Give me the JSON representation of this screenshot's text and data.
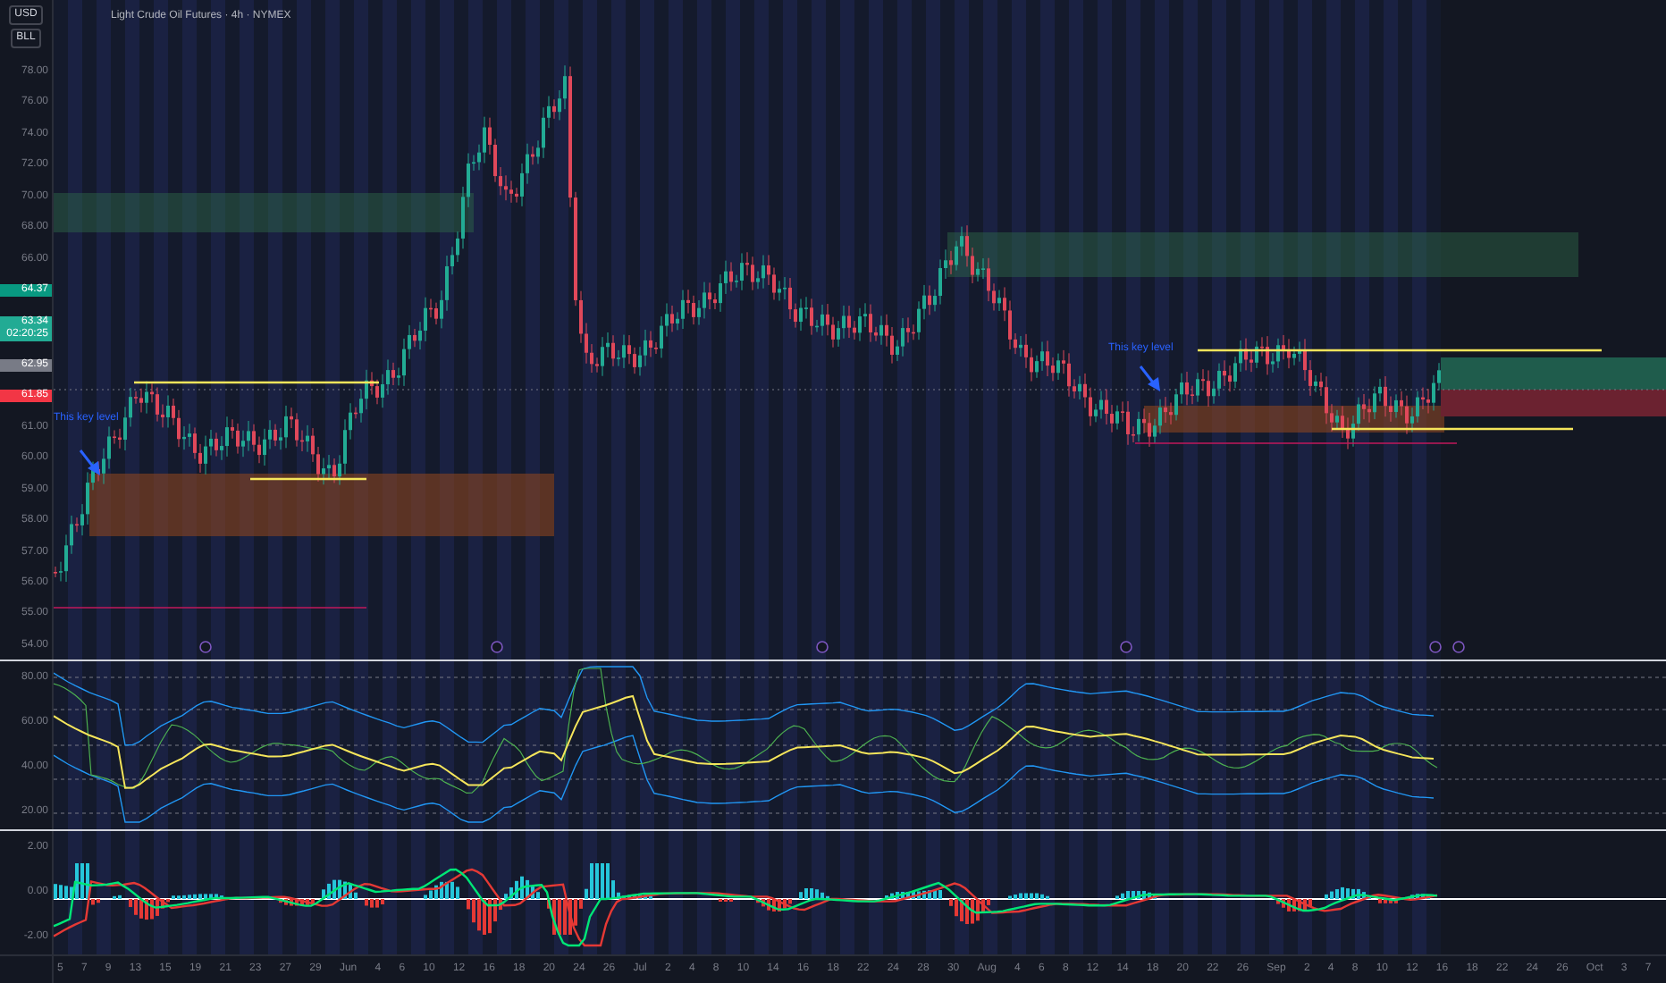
{
  "header": {
    "currency": "USD",
    "mode": "BLL",
    "title": "Light Crude Oil Futures · 4h · NYMEX"
  },
  "price_axis": [
    {
      "kind": "tick",
      "label": "78.00"
    },
    {
      "kind": "tick",
      "label": "76.00"
    },
    {
      "kind": "tick",
      "label": "74.00"
    },
    {
      "kind": "tick",
      "label": "72.00"
    },
    {
      "kind": "tick",
      "label": "70.00"
    },
    {
      "kind": "tick",
      "label": "68.00"
    },
    {
      "kind": "tick",
      "label": "66.00"
    },
    {
      "kind": "badge",
      "label": "64.37",
      "color": "#089981"
    },
    {
      "kind": "badge",
      "label": "63.34",
      "sub": "02:20:25",
      "color": "#22ab94"
    },
    {
      "kind": "badge",
      "label": "62.95",
      "color": "#787b86"
    },
    {
      "kind": "badge",
      "label": "61.85",
      "color": "#f23645"
    },
    {
      "kind": "tick",
      "label": "61.00"
    },
    {
      "kind": "tick",
      "label": "60.00"
    },
    {
      "kind": "tick",
      "label": "59.00"
    },
    {
      "kind": "tick",
      "label": "58.00"
    },
    {
      "kind": "tick",
      "label": "57.00"
    },
    {
      "kind": "tick",
      "label": "56.00"
    },
    {
      "kind": "tick",
      "label": "55.00"
    },
    {
      "kind": "tick",
      "label": "54.00"
    }
  ],
  "annotations": [
    "This key level",
    "This key level"
  ],
  "rsi_axis": [
    "80.00",
    "60.00",
    "40.00",
    "20.00"
  ],
  "macd_axis": [
    "2.00",
    "0.00",
    "-2.00"
  ],
  "date_axis": [
    "5",
    "7",
    "9",
    "13",
    "15",
    "19",
    "21",
    "23",
    "27",
    "29",
    "Jun",
    "4",
    "6",
    "10",
    "12",
    "16",
    "18",
    "20",
    "24",
    "26",
    "Jul",
    "2",
    "4",
    "8",
    "10",
    "14",
    "16",
    "18",
    "22",
    "24",
    "28",
    "30",
    "Aug",
    "4",
    "6",
    "8",
    "12",
    "14",
    "18",
    "20",
    "22",
    "26",
    "Sep",
    "2",
    "4",
    "8",
    "10",
    "12",
    "16",
    "18",
    "22",
    "24",
    "26",
    "Oct",
    "3",
    "7"
  ]
}
